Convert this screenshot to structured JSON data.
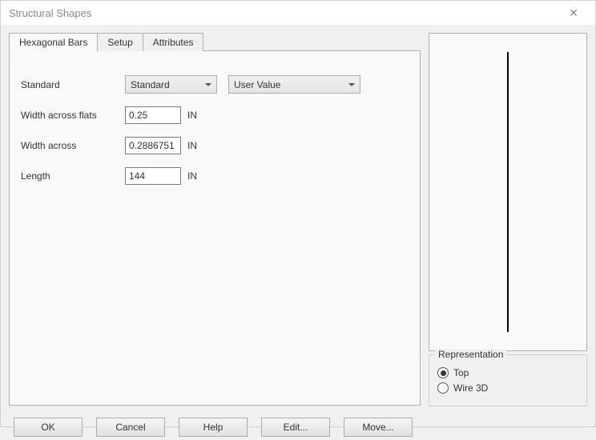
{
  "title": "Structural Shapes",
  "tabs": {
    "hexagonal": "Hexagonal Bars",
    "setup": "Setup",
    "attributes": "Attributes"
  },
  "form": {
    "standard_label": "Standard",
    "standard_value": "Standard",
    "user_value": "User Value",
    "width_flats_label": "Width across flats",
    "width_flats_value": "0.25",
    "width_flats_unit": "IN",
    "width_across_label": "Width across",
    "width_across_value": "0.2886751",
    "width_across_unit": "IN",
    "length_label": "Length",
    "length_value": "144",
    "length_unit": "IN"
  },
  "representation": {
    "legend": "Representation",
    "top": "Top",
    "wire3d": "Wire 3D",
    "selected": "top"
  },
  "buttons": {
    "ok": "OK",
    "cancel": "Cancel",
    "help": "Help",
    "edit": "Edit...",
    "move": "Move..."
  },
  "close_glyph": "✕"
}
